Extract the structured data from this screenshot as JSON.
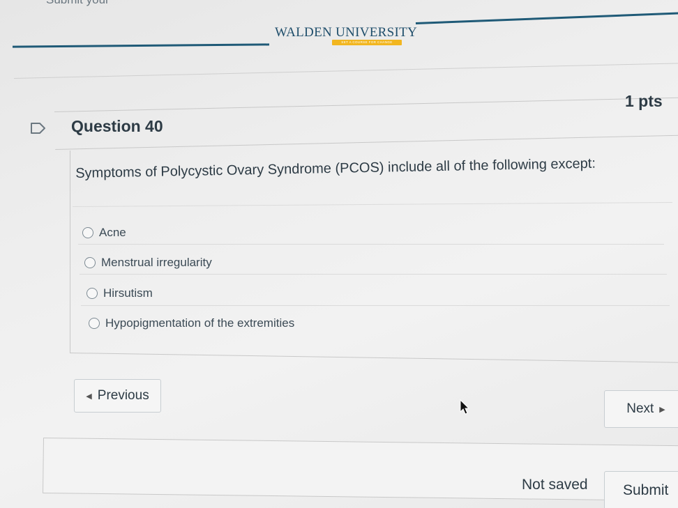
{
  "top_cut_text": "Submit your",
  "banner": {
    "logo_word1": "WALDEN",
    "logo_word2": "UNIVERSITY",
    "logo_tagline": "SET A COURSE FOR CHANGE"
  },
  "question": {
    "title": "Question 40",
    "points": "1 pts",
    "text": "Symptoms of Polycystic Ovary Syndrome (PCOS) include all of the following except:",
    "answers": [
      "Acne",
      "Menstrual irregularity",
      "Hirsutism",
      "Hypopigmentation of the extremities"
    ]
  },
  "nav": {
    "previous_label": "Previous",
    "next_label": "Next"
  },
  "footer": {
    "status": "Not saved",
    "submit_label": "Submit"
  },
  "icons": {
    "flag": "flag-icon",
    "prev": "triangle-left-icon",
    "next": "triangle-right-icon",
    "cursor": "mouse-pointer-icon"
  },
  "colors": {
    "brand_blue": "#1f5a77",
    "brand_gold": "#f2b620",
    "text": "#2d3b45"
  }
}
